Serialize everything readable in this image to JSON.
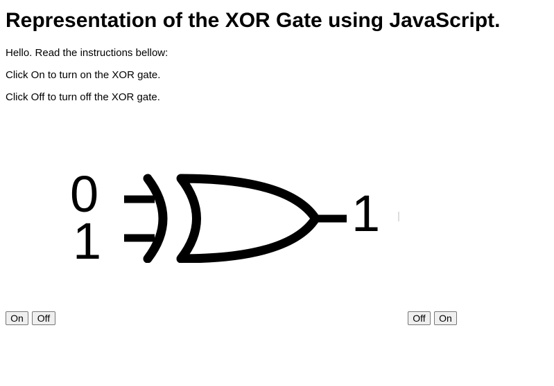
{
  "page": {
    "title": "Representation of the XOR Gate using JavaScript.",
    "paragraphs": [
      "Hello. Read the instructions bellow:",
      "Click On to turn on the XOR gate.",
      "Click Off to turn off the XOR gate."
    ]
  },
  "gate": {
    "input_a": "0",
    "input_b": "1",
    "output": "1",
    "stroke_color": "#000000"
  },
  "controls": {
    "left": {
      "on_label": "On",
      "off_label": "Off"
    },
    "right": {
      "off_label": "Off",
      "on_label": "On"
    }
  }
}
